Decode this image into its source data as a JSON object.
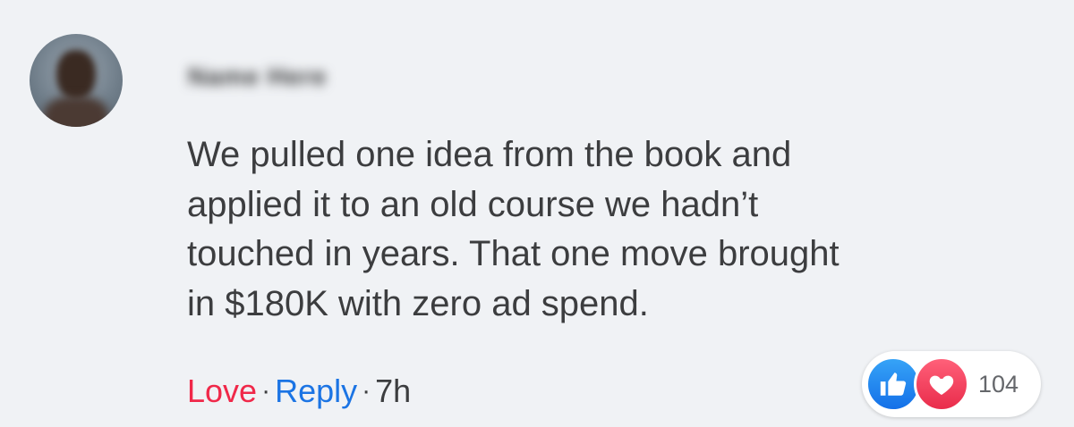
{
  "comment": {
    "author_name": "Name Here",
    "text": "We pulled one idea from the book and\napplied it to an old course we hadn’t\ntouched in years. That one move brought\nin $180K with zero ad spend."
  },
  "actions": {
    "love": "Love",
    "separator": "·",
    "reply": "Reply",
    "time": "7h"
  },
  "reactions": {
    "icons": [
      "like-icon",
      "love-icon"
    ],
    "count": "104"
  },
  "colors": {
    "background": "#f0f2f5",
    "love": "#f02849",
    "reply": "#1b74e4",
    "text": "#3c3d3f"
  }
}
